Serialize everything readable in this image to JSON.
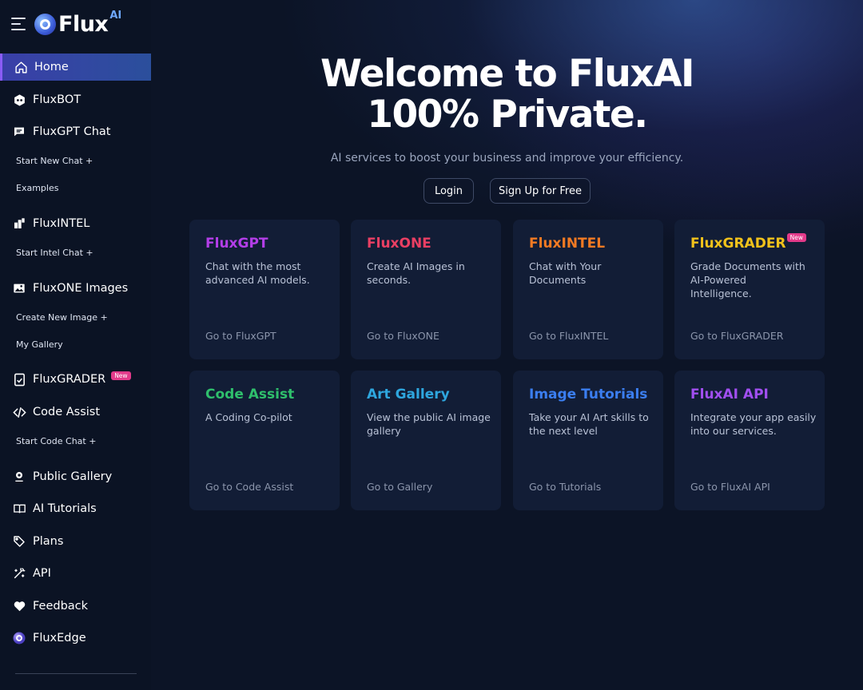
{
  "brand": {
    "name": "Flux",
    "superscript": "AI"
  },
  "sidebar": {
    "items": [
      {
        "label": "Home",
        "icon": "home-icon",
        "active": true
      },
      {
        "label": "FluxBOT",
        "icon": "bot-icon"
      },
      {
        "label": "FluxGPT Chat",
        "icon": "chat-icon"
      },
      {
        "label": "FluxINTEL",
        "icon": "intel-icon"
      },
      {
        "label": "FluxONE Images",
        "icon": "image-icon"
      },
      {
        "label": "FluxGRADER",
        "icon": "grader-icon",
        "badge": "New"
      },
      {
        "label": "Code Assist",
        "icon": "code-icon"
      },
      {
        "label": "Public Gallery",
        "icon": "gallery-icon"
      },
      {
        "label": "AI Tutorials",
        "icon": "book-icon"
      },
      {
        "label": "Plans",
        "icon": "tag-icon"
      },
      {
        "label": "API",
        "icon": "wand-icon"
      },
      {
        "label": "Feedback",
        "icon": "heart-icon"
      },
      {
        "label": "FluxEdge",
        "icon": "fluxedge-icon"
      }
    ],
    "subitems": {
      "start_new_chat": "Start New Chat +",
      "examples": "Examples",
      "start_intel_chat": "Start Intel Chat +",
      "create_new_image": "Create New Image +",
      "my_gallery": "My Gallery",
      "start_code_chat": "Start Code Chat +"
    }
  },
  "hero": {
    "title_line1": "Welcome to FluxAI",
    "title_line2": "100% Private.",
    "subtitle": "AI services to boost your business and improve your efficiency.",
    "login_label": "Login",
    "signup_label": "Sign Up for Free"
  },
  "cards": [
    {
      "title": "FluxGPT",
      "desc": "Chat with the most advanced AI models.",
      "link": "Go to FluxGPT",
      "color": "#b33ee8"
    },
    {
      "title": "FluxONE",
      "desc": "Create AI Images in seconds.",
      "link": "Go to FluxONE",
      "color": "#ea3f63"
    },
    {
      "title": "FluxINTEL",
      "desc": "Chat with Your Documents",
      "link": "Go to FluxINTEL",
      "color": "#f37a23"
    },
    {
      "title": "FluxGRADER",
      "desc": "Grade Documents with AI-Powered Intelligence.",
      "link": "Go to FluxGRADER",
      "color": "#f2c21b",
      "badge": "New"
    },
    {
      "title": "Code Assist",
      "desc": "A Coding Co-pilot",
      "link": "Go to Code Assist",
      "color": "#2fbf6c"
    },
    {
      "title": "Art Gallery",
      "desc": "View the public AI image gallery",
      "link": "Go to Gallery",
      "color": "#2ea6de"
    },
    {
      "title": "Image Tutorials",
      "desc": "Take your AI Art skills to the next level",
      "link": "Go to Tutorials",
      "color": "#3b7ef0"
    },
    {
      "title": "FluxAI API",
      "desc": "Integrate your app easily into our services.",
      "link": "Go to FluxAI API",
      "color": "#a14ff0"
    }
  ]
}
